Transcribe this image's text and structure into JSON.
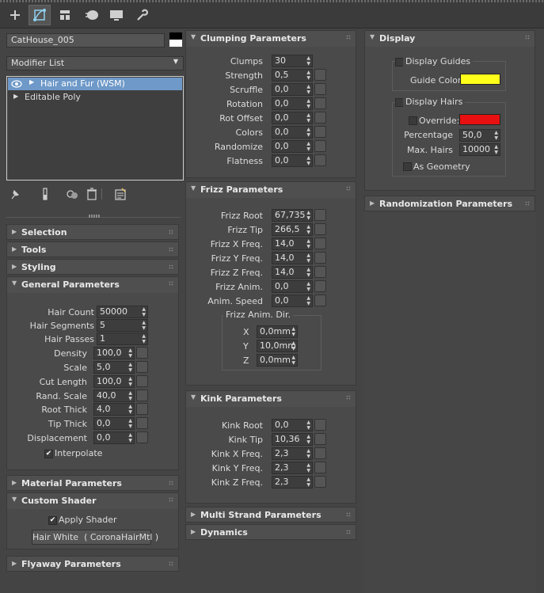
{
  "object_name": "CatHouse_005",
  "modifier_list_label": "Modifier List",
  "stack": [
    {
      "label": "Hair and Fur (WSM)"
    },
    {
      "label": "Editable Poly"
    }
  ],
  "left_rollouts": {
    "selection": "Selection",
    "tools": "Tools",
    "styling": "Styling",
    "general": "General Parameters",
    "material": "Material Parameters",
    "custom_shader": "Custom Shader",
    "flyaway": "Flyaway Parameters"
  },
  "general": {
    "hair_count": {
      "label": "Hair Count",
      "value": "50000"
    },
    "hair_segments": {
      "label": "Hair Segments",
      "value": "5"
    },
    "hair_passes": {
      "label": "Hair Passes",
      "value": "1"
    },
    "density": {
      "label": "Density",
      "value": "100,0"
    },
    "scale": {
      "label": "Scale",
      "value": "5,0"
    },
    "cut_length": {
      "label": "Cut Length",
      "value": "100,0"
    },
    "rand_scale": {
      "label": "Rand. Scale",
      "value": "40,0"
    },
    "root_thick": {
      "label": "Root Thick",
      "value": "4,0"
    },
    "tip_thick": {
      "label": "Tip Thick",
      "value": "0,0"
    },
    "displacement": {
      "label": "Displacement",
      "value": "0,0"
    },
    "interpolate": "Interpolate"
  },
  "custom_shader": {
    "apply_shader": "Apply Shader",
    "shader_button": "Hair White  ( CoronaHairMtl )"
  },
  "clumping": {
    "title": "Clumping Parameters",
    "rows": [
      {
        "label": "Clumps",
        "value": "30"
      },
      {
        "label": "Strength",
        "value": "0,5"
      },
      {
        "label": "Scruffle",
        "value": "0,0"
      },
      {
        "label": "Rotation",
        "value": "0,0"
      },
      {
        "label": "Rot Offset",
        "value": "0,0"
      },
      {
        "label": "Colors",
        "value": "0,0"
      },
      {
        "label": "Randomize",
        "value": "0,0"
      },
      {
        "label": "Flatness",
        "value": "0,0"
      }
    ]
  },
  "frizz": {
    "title": "Frizz Parameters",
    "rows": [
      {
        "label": "Frizz Root",
        "value": "67,735"
      },
      {
        "label": "Frizz Tip",
        "value": "266,5"
      },
      {
        "label": "Frizz X Freq.",
        "value": "14,0"
      },
      {
        "label": "Frizz Y Freq.",
        "value": "14,0"
      },
      {
        "label": "Frizz Z Freq.",
        "value": "14,0"
      },
      {
        "label": "Frizz Anim.",
        "value": "0,0"
      },
      {
        "label": "Anim. Speed",
        "value": "0,0"
      }
    ],
    "anim_dir_title": "Frizz Anim. Dir.",
    "dir": [
      {
        "label": "X",
        "value": "0,0mm"
      },
      {
        "label": "Y",
        "value": "10,0mm"
      },
      {
        "label": "Z",
        "value": "0,0mm"
      }
    ]
  },
  "kink": {
    "title": "Kink Parameters",
    "rows": [
      {
        "label": "Kink Root",
        "value": "0,0"
      },
      {
        "label": "Kink Tip",
        "value": "10,36"
      },
      {
        "label": "Kink X Freq.",
        "value": "2,3"
      },
      {
        "label": "Kink Y Freq.",
        "value": "2,3"
      },
      {
        "label": "Kink Z Freq.",
        "value": "2,3"
      }
    ]
  },
  "multi_strand": "Multi Strand Parameters",
  "dynamics": "Dynamics",
  "display": {
    "title": "Display",
    "display_guides": "Display Guides",
    "guide_color_label": "Guide Color",
    "guide_color": "#ffff1a",
    "display_hairs": "Display Hairs",
    "override": "Override:",
    "override_color": "#e81010",
    "percentage": {
      "label": "Percentage",
      "value": "50,0"
    },
    "max_hairs": {
      "label": "Max. Hairs",
      "value": "10000"
    },
    "as_geometry": "As Geometry"
  },
  "randomization": "Randomization Parameters"
}
